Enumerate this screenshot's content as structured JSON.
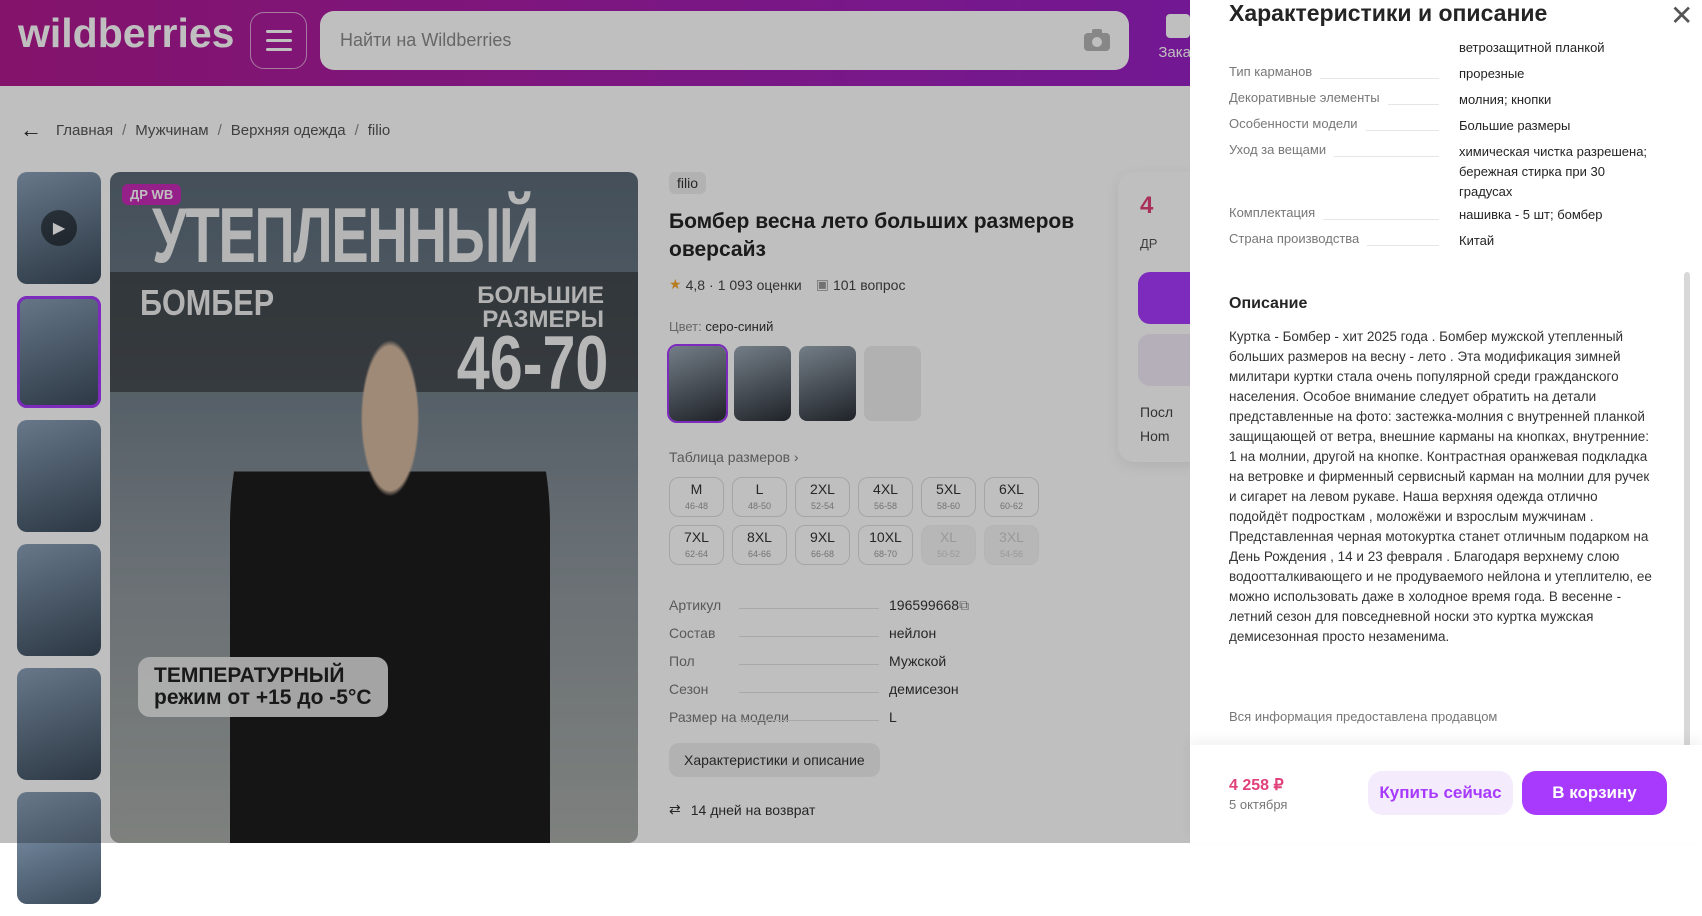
{
  "header": {
    "logo": "wildberries",
    "search_placeholder": "Найти на Wildberries",
    "orders_label": "Заказ"
  },
  "breadcrumbs": [
    "Главная",
    "Мужчинам",
    "Верхняя одежда",
    "filio"
  ],
  "image": {
    "badge": "ДР WB",
    "headline": "УТЕПЛЕННЫЙ",
    "left_word": "БОМБЕР",
    "right_words": "БОЛЬШИЕ РАЗМЕРЫ",
    "sizes_text": "46-70",
    "temperature_line1": "ТЕМПЕРАТУРНЫЙ",
    "temperature_line2": "режим от +15 до -5°С"
  },
  "product": {
    "brand": "filio",
    "title": "Бомбер весна лето больших размеров оверсайз",
    "rating": "4,8",
    "reviews": "1 093 оценки",
    "questions": "101 вопрос",
    "color_label": "Цвет:",
    "color_value": "серо-синий",
    "size_table_label": "Таблица размеров",
    "sizes": [
      {
        "label": "M",
        "range": "46-48",
        "available": true
      },
      {
        "label": "L",
        "range": "48-50",
        "available": true
      },
      {
        "label": "2XL",
        "range": "52-54",
        "available": true
      },
      {
        "label": "4XL",
        "range": "56-58",
        "available": true
      },
      {
        "label": "5XL",
        "range": "58-60",
        "available": true
      },
      {
        "label": "6XL",
        "range": "60-62",
        "available": true
      },
      {
        "label": "7XL",
        "range": "62-64",
        "available": true
      },
      {
        "label": "8XL",
        "range": "64-66",
        "available": true
      },
      {
        "label": "9XL",
        "range": "66-68",
        "available": true
      },
      {
        "label": "10XL",
        "range": "68-70",
        "available": true
      },
      {
        "label": "XL",
        "range": "50-52",
        "available": false
      },
      {
        "label": "3XL",
        "range": "54-56",
        "available": false
      }
    ],
    "specs": [
      {
        "key": "Артикул",
        "value": "196599668"
      },
      {
        "key": "Состав",
        "value": "нейлон"
      },
      {
        "key": "Пол",
        "value": "Мужской"
      },
      {
        "key": "Сезон",
        "value": "демисезон"
      },
      {
        "key": "Размер на модели",
        "value": "L"
      }
    ],
    "char_button": "Характеристики и описание",
    "return_text": "14 дней на возврат"
  },
  "pricebox": {
    "price_partial": "4",
    "dr_partial": "ДР ",
    "line1_partial": "Посл",
    "line2_partial": "Hom"
  },
  "panel": {
    "title": "Характеристики и описание",
    "rows": [
      {
        "key": "",
        "value": "ветрозащитной планкой"
      },
      {
        "key": "Тип карманов",
        "value": "прорезные"
      },
      {
        "key": "Декоративные элементы",
        "value": "молния; кнопки"
      },
      {
        "key": "Особенности модели",
        "value": "Большие размеры"
      },
      {
        "key": "Уход за вещами",
        "value": "химическая чистка разрешена; бережная стирка при 30 градусах"
      },
      {
        "key": "Комплектация",
        "value": "нашивка - 5 шт; бомбер"
      },
      {
        "key": "Страна производства",
        "value": "Китай"
      }
    ],
    "description_title": "Описание",
    "description": "Куртка - Бомбер - хит 2025 года . Бомбер мужской утепленный больших размеров на весну - лето . Эта модификация зимней милитари куртки стала очень популярной среди гражданского населения. Особое внимание следует обратить на детали представленные на фото: застежка-молния с внутренней планкой защищающей от ветра, внешние карманы на кнопках, внутренние: 1 на молнии, другой на кнопке. Контрастная оранжевая подкладка на ветровке и фирменный сервисный карман на молнии для ручек и сигарет на левом рукаве. Наша верхняя одежда отлично подойдёт подросткам , моложёжи и взрослым мужчинам . Представленная черная мотокуртка станет отличным подарком на День Рождения , 14 и 23 февраля . Благодаря верхнему слою водоотталкивающего и не продуваемого нейлона и утеплителю, ее можно использовать даже в холодное время года. В весенне - летний сезон для повседневной носки это куртка мужская демисезонная просто незаменима.",
    "footnote": "Вся информация предоставлена продавцом",
    "price": "4 258 ₽",
    "date": "5 октября",
    "buy_now": "Купить сейчас",
    "to_cart": "В корзину"
  }
}
